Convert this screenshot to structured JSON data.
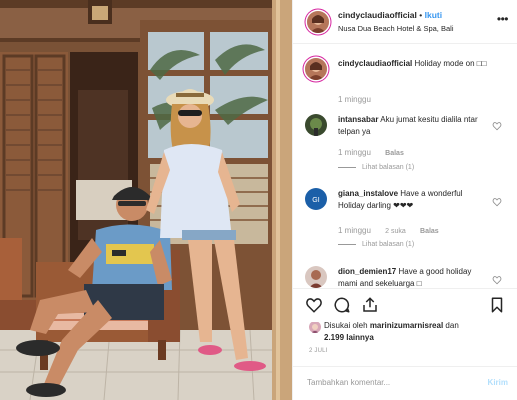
{
  "post": {
    "username": "cindyclaudiaofficial",
    "separator": "•",
    "follow_label": "Ikuti",
    "location": "Nusa Dua Beach Hotel & Spa, Bali",
    "more_label": "•••"
  },
  "comments": [
    {
      "username": "cindyclaudiaofficial",
      "text": "Holiday mode on □□",
      "time": "1 minggu"
    },
    {
      "username": "intansabar",
      "text": "Aku jumat kesitu dialila ntar telpan ya",
      "time": "1 minggu",
      "reply_label": "Balas",
      "view_replies": "Lihat balasan (1)"
    },
    {
      "username": "giana_instalove",
      "text": "Have a wonderful Holiday darling ❤❤❤",
      "time": "1 minggu",
      "likes": "2 suka",
      "reply_label": "Balas",
      "view_replies": "Lihat balasan (1)"
    },
    {
      "username": "dion_demien17",
      "text": "Have a good holiday mami and sekeluarga □"
    }
  ],
  "likes": {
    "prefix": "Disukai oleh",
    "user": "marinizumarnisreal",
    "joiner": "dan",
    "others": "2.199 lainnya"
  },
  "date": "2 JULI",
  "add_comment": {
    "placeholder": "Tambahkan komentar...",
    "post_label": "Kirim"
  },
  "colors": {
    "link_blue": "#3897f0",
    "post_disabled": "#b2dffc",
    "muted": "#999999",
    "text": "#262626",
    "border": "#efefef"
  },
  "icons": [
    "heart-icon",
    "comment-icon",
    "share-icon",
    "bookmark-icon",
    "more-options-icon"
  ]
}
